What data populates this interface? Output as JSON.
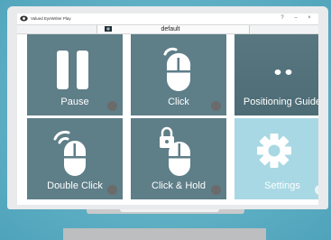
{
  "window": {
    "title": "Valued EyeWriter Play",
    "controls": [
      "?",
      "–",
      "×"
    ]
  },
  "profile": {
    "name": "default",
    "icon": "profile-icon"
  },
  "tiles": [
    {
      "label": "Pause",
      "icon": "pause-icon"
    },
    {
      "label": "Click",
      "icon": "mouse-click-icon"
    },
    {
      "label": "Positioning Guide",
      "icon": "eyes-icon"
    },
    {
      "label": "Double Click",
      "icon": "mouse-double-click-icon"
    },
    {
      "label": "Click & Hold",
      "icon": "mouse-lock-icon"
    },
    {
      "label": "Settings",
      "icon": "gear-icon"
    }
  ],
  "colors": {
    "background": "#5fb0c5",
    "tile_dark": "#5e7e88",
    "tile_light": "#a8d8e3",
    "indicator": "#6b6b6b"
  }
}
